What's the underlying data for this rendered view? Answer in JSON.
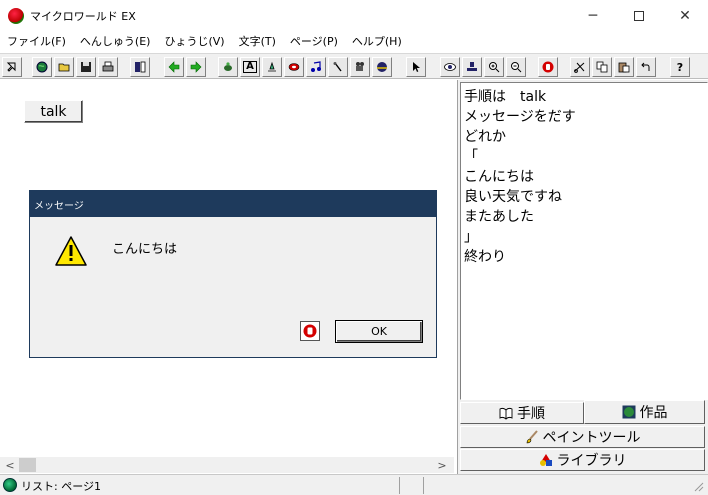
{
  "window": {
    "title": "マイクロワールド EX"
  },
  "menu": [
    "ファイル(F)",
    "へんしゅう(E)",
    "ひょうじ(V)",
    "文字(T)",
    "ページ(P)",
    "ヘルプ(H)"
  ],
  "toolbar": {
    "text_tool_glyph": "A",
    "help_glyph": "?"
  },
  "canvas": {
    "talk_button_label": "talk"
  },
  "dialog": {
    "title": "メッセージ",
    "message": "こんにちは",
    "ok_label": "OK"
  },
  "script": {
    "lines": [
      "手順は　talk",
      "メッセージをだす",
      "どれか",
      "「",
      "こんにちは",
      "良い天気ですね",
      "またあした",
      "」",
      "終わり"
    ]
  },
  "tabs": {
    "steps": "手順",
    "work": "作品",
    "paint": "ペイントツール",
    "library": "ライブラリ"
  },
  "status": {
    "text": "リスト: ページ1"
  },
  "colors": {
    "dialog_title_bg": "#1e3a5c",
    "warning": "#ffe800",
    "stop_red": "#d40000"
  }
}
